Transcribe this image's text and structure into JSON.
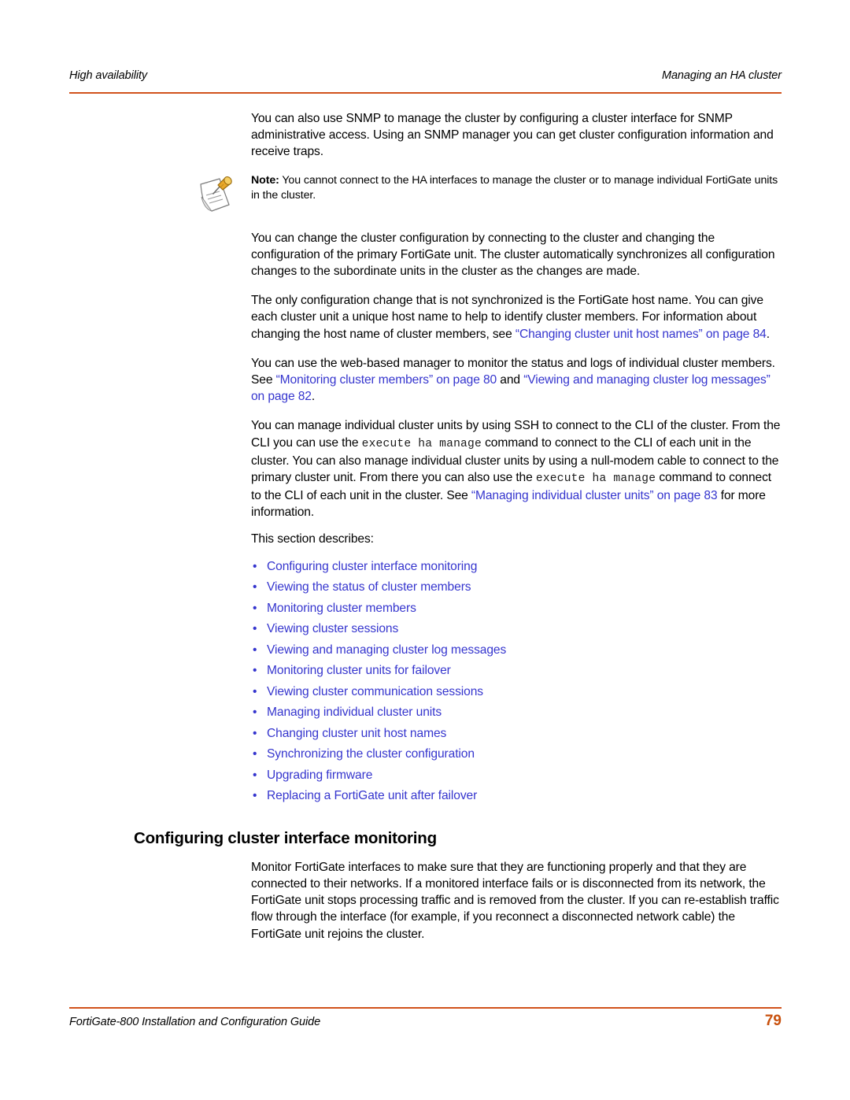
{
  "colors": {
    "rule": "#D1521C",
    "link": "#3535CE",
    "page_number": "#C8500C",
    "text": "#000000"
  },
  "header": {
    "left": "High availability",
    "right": "Managing an HA cluster"
  },
  "footer": {
    "title": "FortiGate-800 Installation and Configuration Guide",
    "page_number": "79"
  },
  "body": {
    "para_snmp": "You can also use SNMP to manage the cluster by configuring a cluster interface for SNMP administrative access. Using an SNMP manager you can get cluster configuration information and receive traps.",
    "note": {
      "icon": "note-pushpin-icon",
      "label": "Note:",
      "text": "You cannot connect to the HA interfaces to manage the cluster or to manage individual FortiGate units in the cluster."
    },
    "para_change_config": "You can change the cluster configuration by connecting to the cluster and changing the configuration of the primary FortiGate unit. The cluster automatically synchronizes all configuration changes to the subordinate units in the cluster as the changes are made.",
    "para_hostname": {
      "text_1": "The only configuration change that is not synchronized is the FortiGate host name. You can give each cluster unit a unique host name to help to identify cluster members. For information about changing the host name of cluster members, see ",
      "link_1": "“Changing cluster unit host names” on page 84",
      "text_2": "."
    },
    "para_webmanager": {
      "text_1": "You can use the web-based manager to monitor the status and logs of individual cluster members. See ",
      "link_1": "“Monitoring cluster members” on page 80",
      "text_2": " and ",
      "link_2": "“Viewing and managing cluster log messages” on page 82",
      "text_3": "."
    },
    "para_ssh": {
      "text_1": "You can manage individual cluster units by using SSH to connect to the CLI of the cluster. From the CLI you can use the ",
      "code_1": "execute ha manage",
      "text_2": " command to connect to the CLI of each unit in the cluster. You can also manage individual cluster units by using a null-modem cable to connect to the primary cluster unit. From there you can also use the ",
      "code_2": "execute ha manage",
      "text_3": " command to connect to the CLI of each unit in the cluster. See ",
      "link_1": "“Managing individual cluster units” on page 83",
      "text_4": " for more information."
    },
    "section_intro": "This section describes:",
    "bullet_marker": "•",
    "bullets": [
      "Configuring cluster interface monitoring",
      "Viewing the status of cluster members",
      "Monitoring cluster members",
      "Viewing cluster sessions",
      "Viewing and managing cluster log messages",
      "Monitoring cluster units for failover",
      "Viewing cluster communication sessions",
      "Managing individual cluster units",
      "Changing cluster unit host names",
      "Synchronizing the cluster configuration",
      "Upgrading firmware",
      "Replacing a FortiGate unit after failover"
    ],
    "section_heading": "Configuring cluster interface monitoring",
    "para_monitoring": "Monitor FortiGate interfaces to make sure that they are functioning properly and that they are connected to their networks. If a monitored interface fails or is disconnected from its network, the FortiGate unit stops processing traffic and is removed from the cluster. If you can re-establish traffic flow through the interface (for example, if you reconnect a disconnected network cable) the FortiGate unit rejoins the cluster."
  }
}
